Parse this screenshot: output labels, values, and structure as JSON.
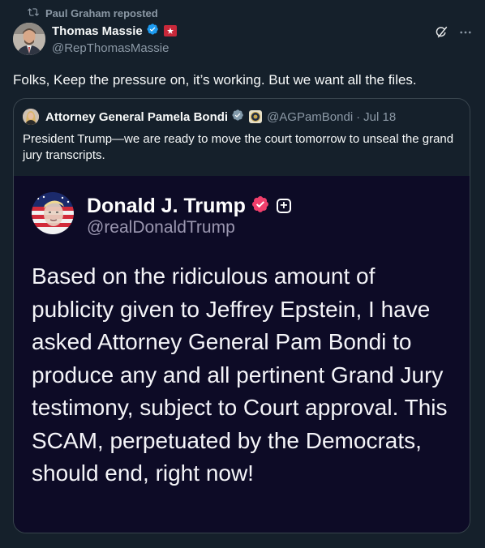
{
  "repost": {
    "label": "Paul Graham reposted",
    "icon": "repost-icon"
  },
  "tweet": {
    "author": {
      "name": "Thomas Massie",
      "handle": "@RepThomasMassie",
      "verified": true,
      "affiliation_badge": "house-affiliation-badge"
    },
    "text": "Folks, Keep the pressure on, it’s working. But we want all the files.",
    "actions": [
      "grok-icon",
      "more-icon"
    ]
  },
  "quote": {
    "author": {
      "name": "Attorney General Pamela Bondi",
      "handle": "@AGPamBondi",
      "separator": "·",
      "date": "Jul 18",
      "verified": true,
      "affiliation_badge": "doj-seal"
    },
    "text": "President Trump—we are ready to move the court tomorrow to unseal the grand jury transcripts."
  },
  "media": {
    "name": "Donald J. Trump",
    "handle": "@realDonaldTrump",
    "plus_label": "+",
    "body": "Based on the ridiculous amount of publicity given to Jeffrey Epstein, I have asked Attorney General Pam Bondi to produce any and all pertinent Grand Jury testimony, subject to Court approval. This SCAM, perpetuated by the Democrats, should end, right now!"
  },
  "colors": {
    "background": "#15202b",
    "text_primary": "#f7f9f9",
    "text_secondary": "#8b98a5",
    "verified_blue": "#1d9bf0",
    "truth_bg": "#0d0b26",
    "truth_check": "#f13f6c",
    "border": "#38444d"
  }
}
